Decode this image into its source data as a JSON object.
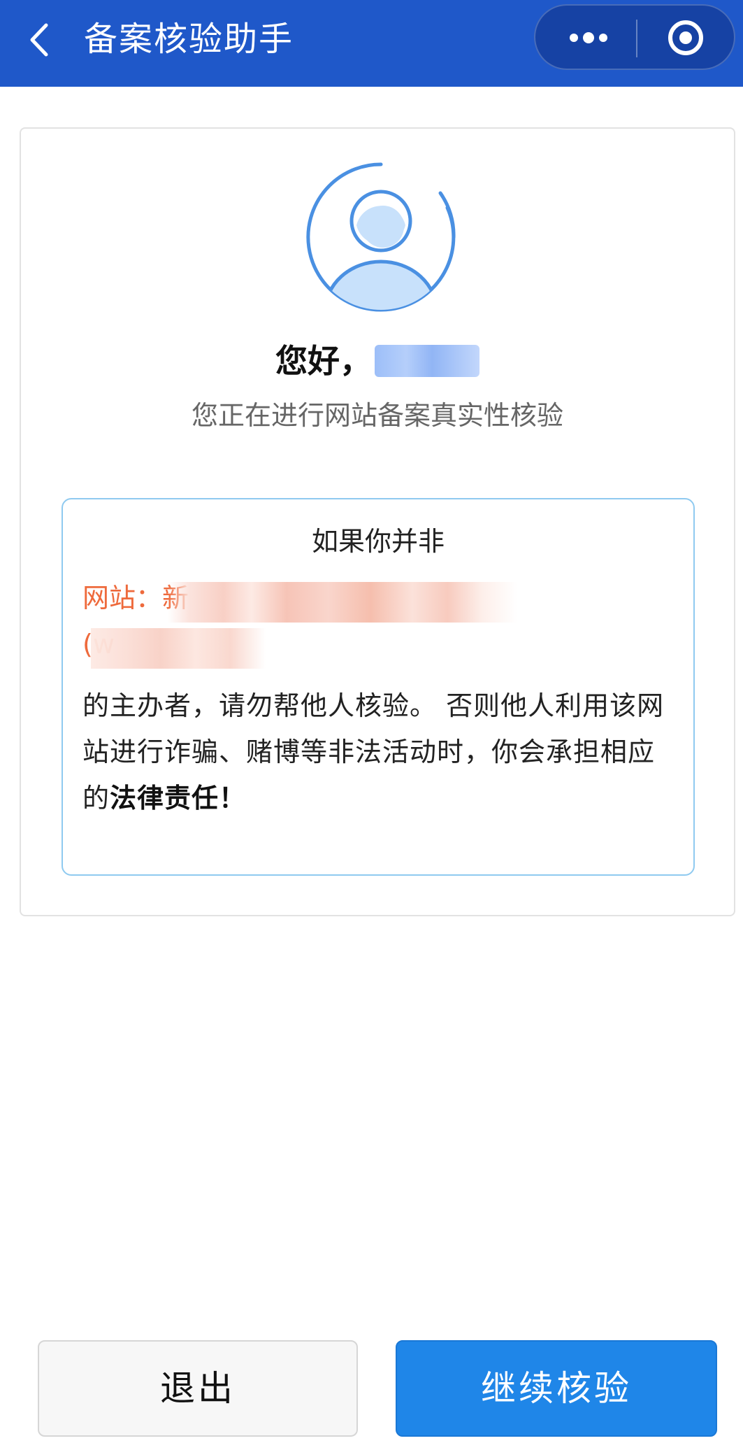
{
  "header": {
    "title": "备案核验助手",
    "back_icon": "chevron-left-icon",
    "more_icon": "more-dots-icon",
    "close_icon": "target-circle-icon",
    "background_color": "#1f58c9"
  },
  "profile": {
    "greeting": "您好，",
    "name_masked": "",
    "subtitle": "您正在进行网站备案真实性核验",
    "avatar_icon": "user-avatar-icon",
    "accent_color": "#4a90e2"
  },
  "warning": {
    "title": "如果你并非",
    "site_prefix": "网站：新",
    "site_line2_prefix": "(w",
    "body_part1": "的主办者，请勿帮他人核验。 否则他人利用该网站进行诈骗、赌博等非法活动时，你会承担相应的",
    "body_emphasis": "法律责任！",
    "site_color": "#ee6a3c",
    "border_color": "#8fcaf0"
  },
  "buttons": {
    "exit_label": "退出",
    "continue_label": "继续核验",
    "continue_color": "#1f86e8"
  }
}
